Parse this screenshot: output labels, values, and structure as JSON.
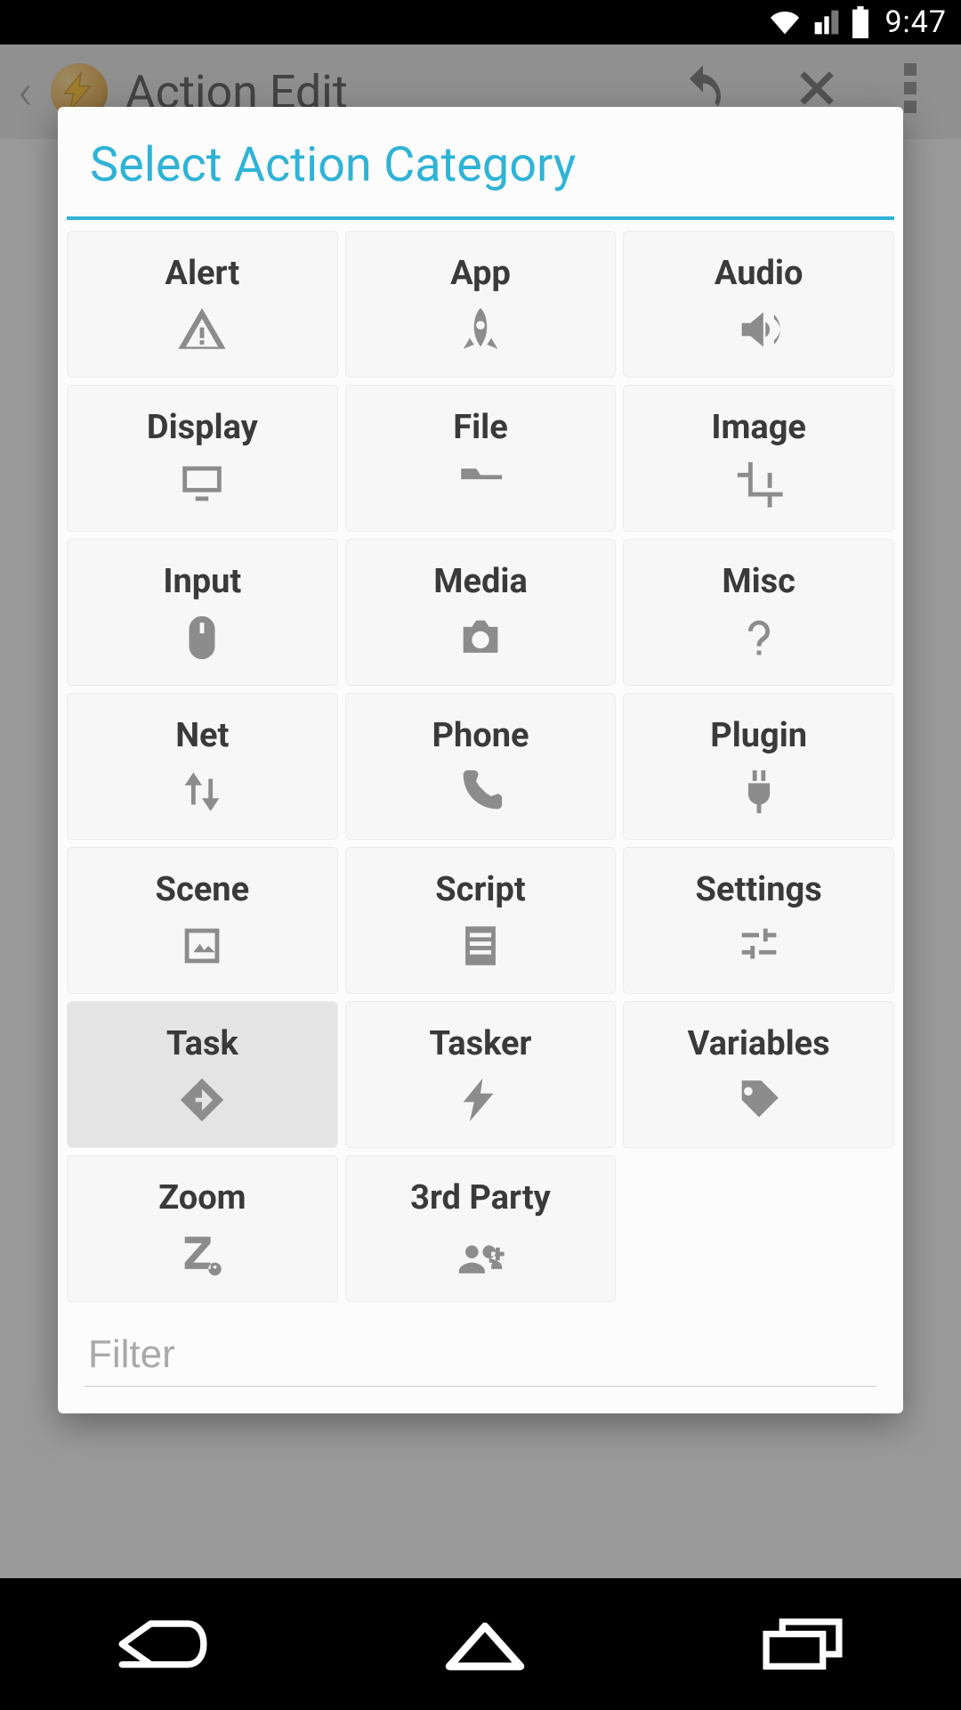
{
  "statusbar": {
    "time": "9:47"
  },
  "appbar": {
    "title": "Action Edit"
  },
  "dialog": {
    "title": "Select Action Category",
    "filter_placeholder": "Filter",
    "categories": [
      {
        "label": "Alert",
        "icon": "warning-icon",
        "pressed": false
      },
      {
        "label": "App",
        "icon": "rocket-icon",
        "pressed": false
      },
      {
        "label": "Audio",
        "icon": "speaker-icon",
        "pressed": false
      },
      {
        "label": "Display",
        "icon": "monitor-icon",
        "pressed": false
      },
      {
        "label": "File",
        "icon": "folder-icon",
        "pressed": false
      },
      {
        "label": "Image",
        "icon": "crop-icon",
        "pressed": false
      },
      {
        "label": "Input",
        "icon": "mouse-icon",
        "pressed": false
      },
      {
        "label": "Media",
        "icon": "camera-icon",
        "pressed": false
      },
      {
        "label": "Misc",
        "icon": "question-icon",
        "pressed": false
      },
      {
        "label": "Net",
        "icon": "updown-icon",
        "pressed": false
      },
      {
        "label": "Phone",
        "icon": "phone-icon",
        "pressed": false
      },
      {
        "label": "Plugin",
        "icon": "plug-icon",
        "pressed": false
      },
      {
        "label": "Scene",
        "icon": "picture-icon",
        "pressed": false
      },
      {
        "label": "Script",
        "icon": "document-icon",
        "pressed": false
      },
      {
        "label": "Settings",
        "icon": "sliders-icon",
        "pressed": false
      },
      {
        "label": "Task",
        "icon": "diamond-arrow-icon",
        "pressed": true
      },
      {
        "label": "Tasker",
        "icon": "lightning-icon",
        "pressed": false
      },
      {
        "label": "Variables",
        "icon": "tag-icon",
        "pressed": false
      },
      {
        "label": "Zoom",
        "icon": "zoom-z-icon",
        "pressed": false
      },
      {
        "label": "3rd Party",
        "icon": "group-add-icon",
        "pressed": false
      }
    ]
  },
  "colors": {
    "accent": "#2fb3d6",
    "icon": "#8c8c8c",
    "text": "#3a3a3a"
  }
}
